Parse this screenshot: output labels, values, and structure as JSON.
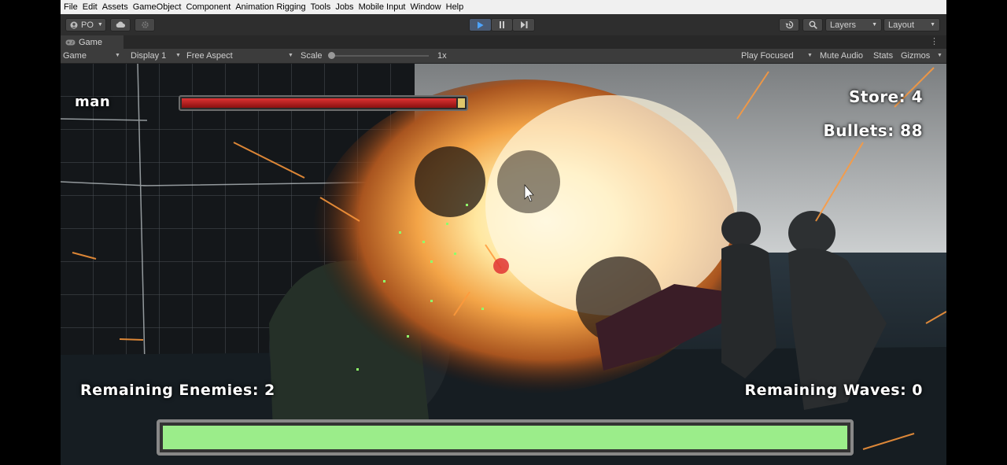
{
  "menu": [
    "File",
    "Edit",
    "Assets",
    "GameObject",
    "Component",
    "Animation Rigging",
    "Tools",
    "Jobs",
    "Mobile Input",
    "Window",
    "Help"
  ],
  "toolbar": {
    "account": "PO",
    "layers": "Layers",
    "layout": "Layout",
    "icons": {
      "account": "account-icon",
      "cloud": "cloud-icon",
      "settings": "gear-icon",
      "play": "play-icon",
      "pause": "pause-icon",
      "step": "step-icon",
      "history": "history-icon",
      "search": "search-icon"
    }
  },
  "window": {
    "tab": "Game"
  },
  "gamebar": {
    "view_mode": "Game",
    "display": "Display 1",
    "aspect": "Free Aspect",
    "scale_label": "Scale",
    "scale_value": "1x",
    "play_focused": "Play Focused",
    "mute_audio": "Mute Audio",
    "stats": "Stats",
    "gizmos": "Gizmos"
  },
  "hud": {
    "player_name": "man",
    "score": "Store: 4",
    "bullets": "Bullets: 88",
    "remaining_enemies": "Remaining Enemies: 2",
    "remaining_waves": "Remaining Waves: 0",
    "player_health_fraction": 0.97,
    "wave_bar_fraction": 1.0
  },
  "colors": {
    "accent": "#4a5a73",
    "health": "#c62828",
    "wave_bar": "#9bed8a"
  }
}
